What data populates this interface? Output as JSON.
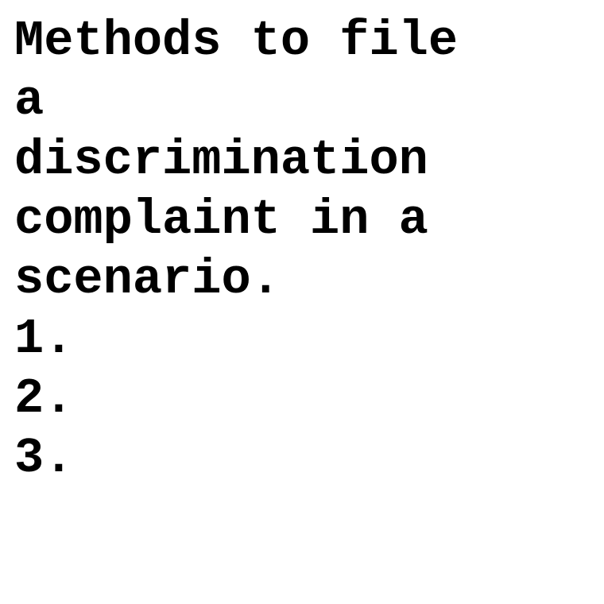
{
  "document": {
    "title_lines": [
      "Methods to file",
      "a",
      "discrimination",
      "complaint in a",
      "scenario."
    ],
    "list_items": [
      "1.",
      "2.",
      "3."
    ]
  }
}
